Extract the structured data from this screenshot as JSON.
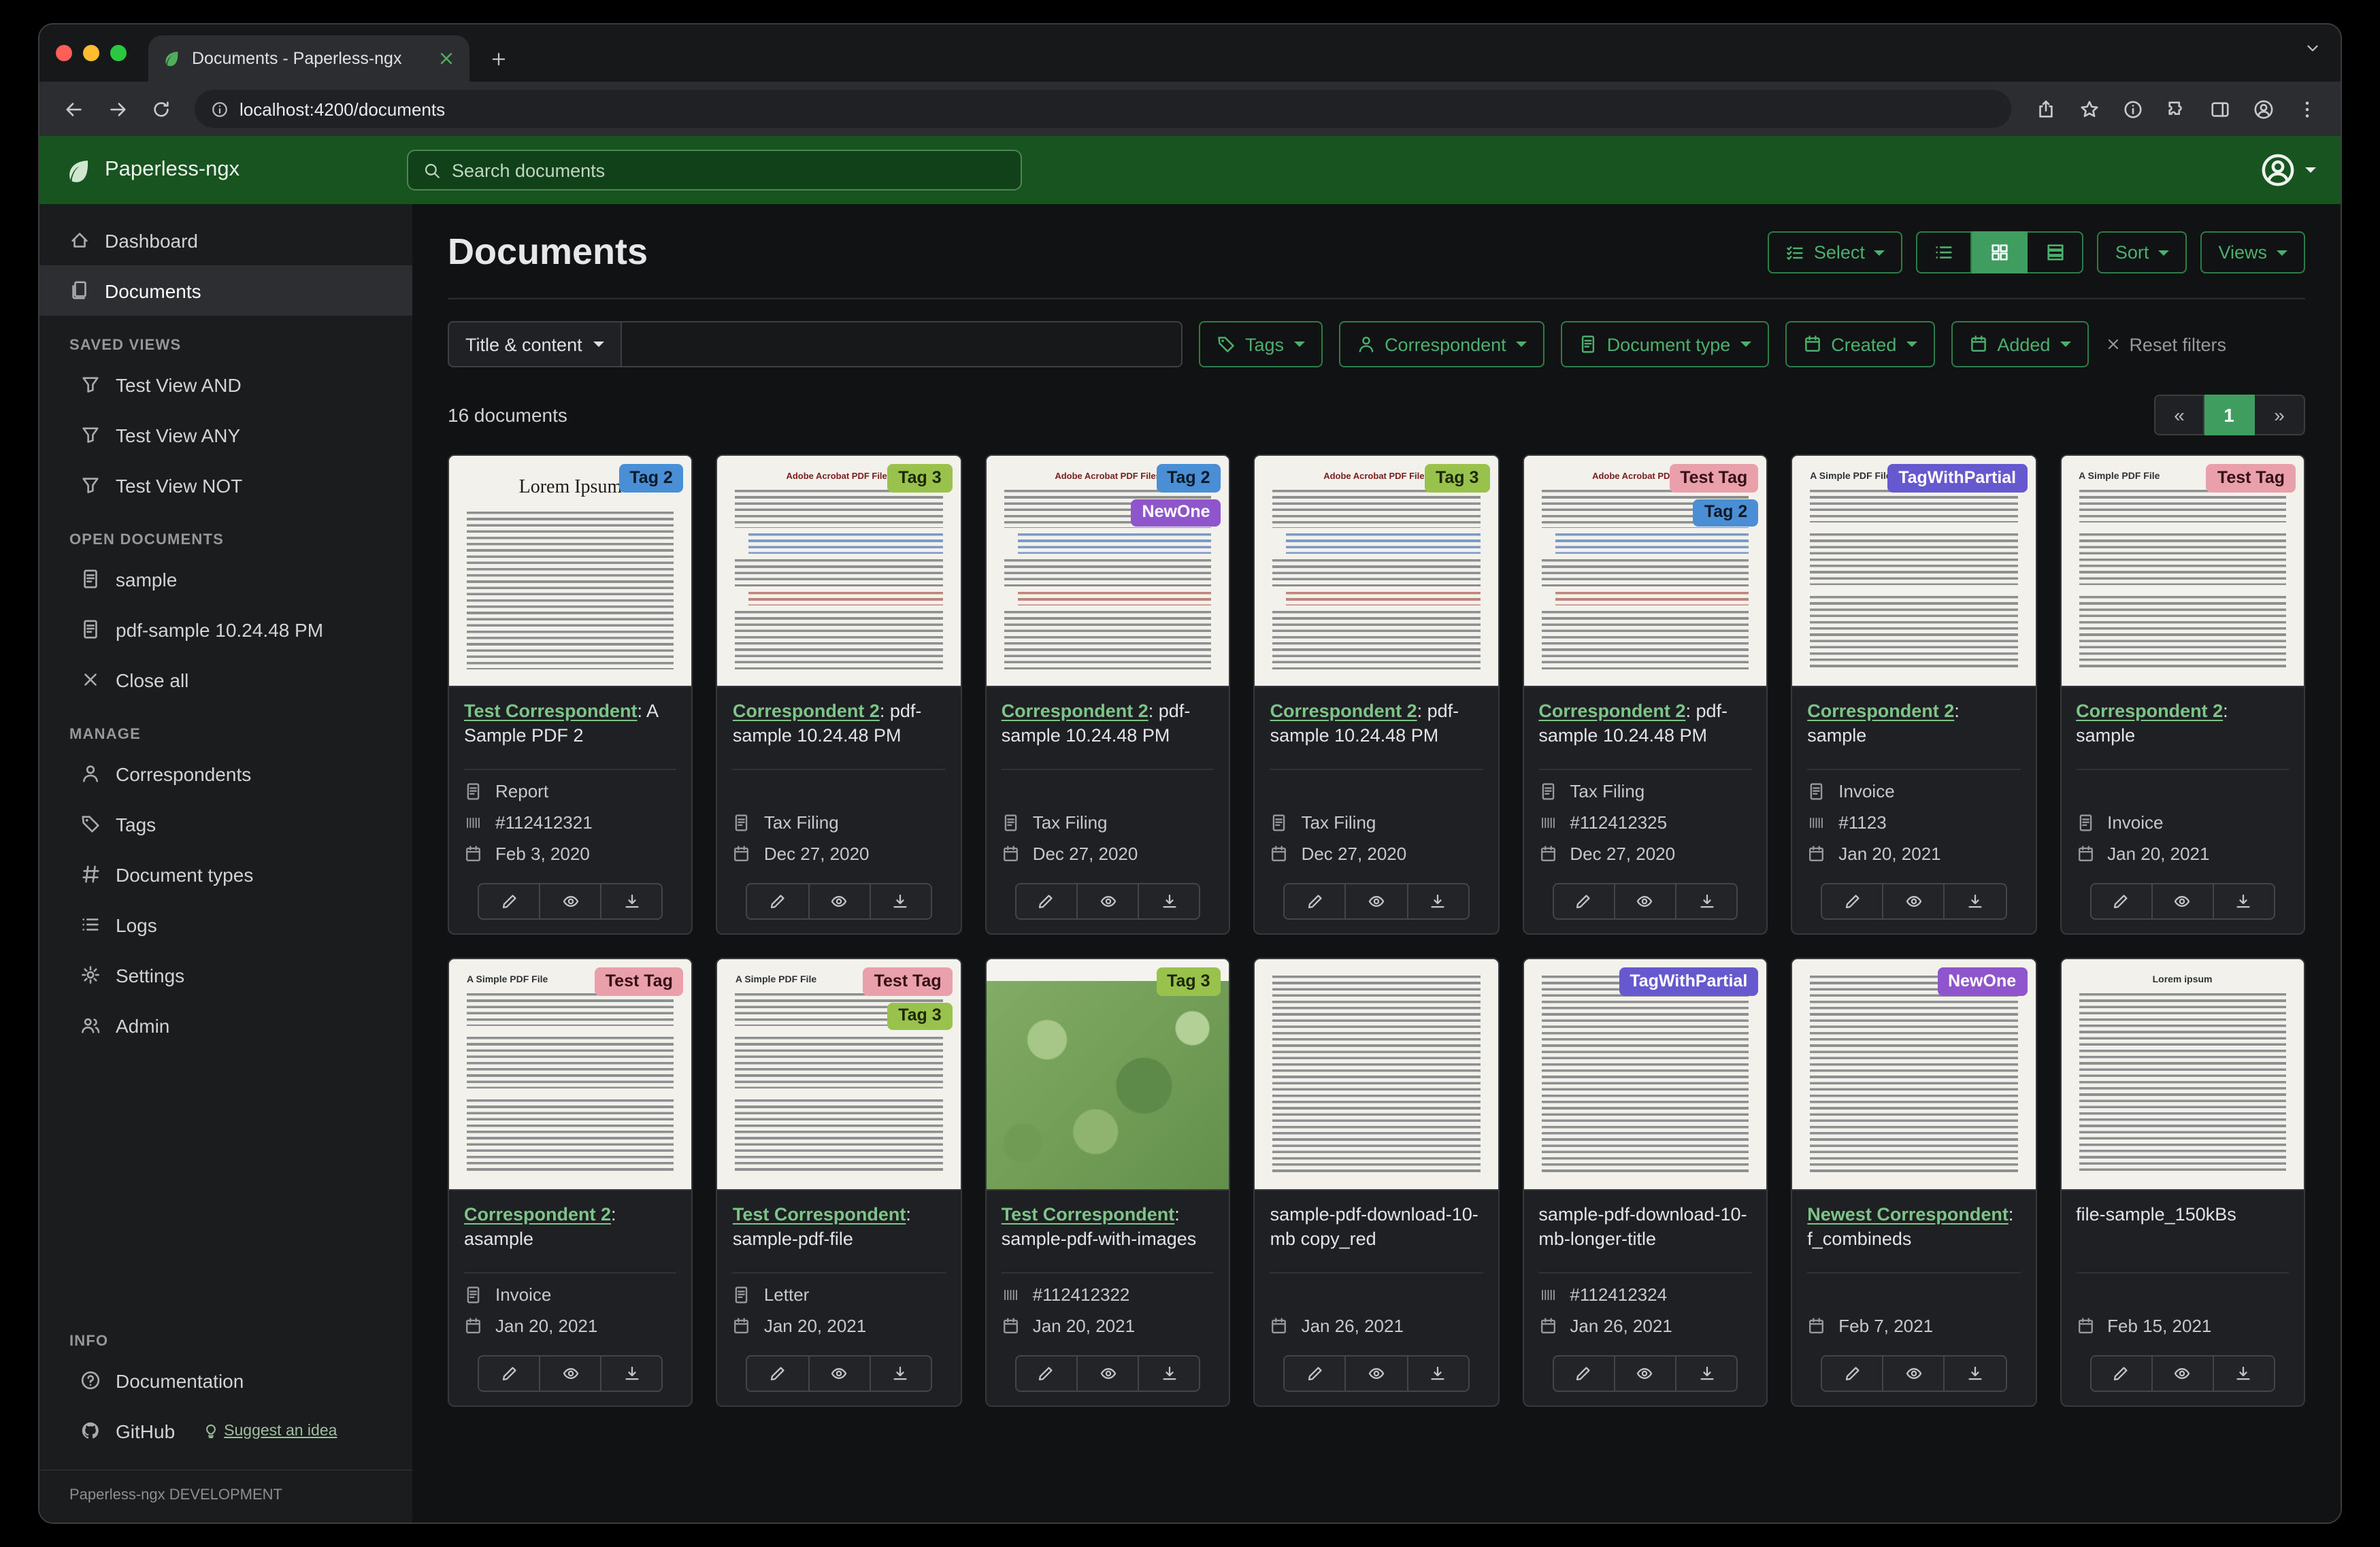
{
  "colors": {
    "brand_green": "#17541f",
    "accent": "#4caf6e",
    "accent_border": "#2e7d49",
    "accent_active": "#3f9e5f",
    "link": "#7ec488"
  },
  "browser": {
    "tab_title": "Documents - Paperless-ngx",
    "url": "localhost:4200/documents"
  },
  "navbar": {
    "brand": "Paperless-ngx",
    "search_placeholder": "Search documents"
  },
  "sidebar": {
    "top_items": [
      {
        "label": "Dashboard",
        "icon": "house"
      },
      {
        "label": "Documents",
        "icon": "files",
        "active": true
      }
    ],
    "sections": [
      {
        "title": "SAVED VIEWS",
        "items": [
          {
            "label": "Test View AND",
            "icon": "funnel"
          },
          {
            "label": "Test View ANY",
            "icon": "funnel"
          },
          {
            "label": "Test View NOT",
            "icon": "funnel"
          }
        ]
      },
      {
        "title": "OPEN DOCUMENTS",
        "items": [
          {
            "label": "sample",
            "icon": "file-text"
          },
          {
            "label": "pdf-sample 10.24.48 PM",
            "icon": "file-text"
          },
          {
            "label": "Close all",
            "icon": "x"
          }
        ]
      },
      {
        "title": "MANAGE",
        "items": [
          {
            "label": "Correspondents",
            "icon": "person"
          },
          {
            "label": "Tags",
            "icon": "tag"
          },
          {
            "label": "Document types",
            "icon": "hash"
          },
          {
            "label": "Logs",
            "icon": "list"
          },
          {
            "label": "Settings",
            "icon": "gear"
          },
          {
            "label": "Admin",
            "icon": "people"
          }
        ]
      },
      {
        "title": "INFO",
        "pin": true,
        "items": [
          {
            "label": "Documentation",
            "icon": "question"
          },
          {
            "label": "GitHub",
            "icon": "github",
            "extra_label": "Suggest an idea",
            "extra_icon": "bulb"
          }
        ]
      }
    ],
    "footer": "Paperless-ngx DEVELOPMENT"
  },
  "main": {
    "title": "Documents",
    "select_label": "Select",
    "sort_label": "Sort",
    "views_label": "Views",
    "count_text": "16 documents",
    "pagination": {
      "prev": "«",
      "page": "1",
      "next": "»"
    }
  },
  "filters": {
    "title_content_label": "Title & content",
    "query_value": "",
    "buttons": [
      {
        "label": "Tags",
        "icon": "tag"
      },
      {
        "label": "Correspondent",
        "icon": "person"
      },
      {
        "label": "Document type",
        "icon": "file-text"
      },
      {
        "label": "Created",
        "icon": "calendar"
      },
      {
        "label": "Added",
        "icon": "calendar"
      }
    ],
    "reset_label": "Reset filters"
  },
  "tag_colors": {
    "Tag 2": {
      "bg": "#4a8ed5",
      "fg": "#0c1a28"
    },
    "Tag 3": {
      "bg": "#98c24b",
      "fg": "#1c2608"
    },
    "NewOne": {
      "bg": "#8e55cc",
      "fg": "#ffffff"
    },
    "Test Tag": {
      "bg": "#e9a0ab",
      "fg": "#351016"
    },
    "TagWithPartial": {
      "bg": "#6658cf",
      "fg": "#ffffff"
    }
  },
  "cards": [
    {
      "tags": [
        "Tag 2"
      ],
      "thumb": {
        "kind": "lorem",
        "heading": "Lorem Ipsum"
      },
      "title_link": "Test Correspondent",
      "title_rest": ": A Sample PDF 2",
      "type": "Report",
      "asn": "#112412321",
      "date": "Feb 3, 2020"
    },
    {
      "tags": [
        "Tag 3"
      ],
      "thumb": {
        "kind": "acrobat",
        "heading": "Adobe Acrobat PDF Files"
      },
      "title_link": "Correspondent 2",
      "title_rest": ": pdf-sample 10.24.48 PM",
      "type": "Tax Filing",
      "date": "Dec 27, 2020"
    },
    {
      "tags": [
        "Tag 2",
        "NewOne"
      ],
      "thumb": {
        "kind": "acrobat",
        "heading": "Adobe Acrobat PDF Files"
      },
      "title_link": "Correspondent 2",
      "title_rest": ": pdf-sample 10.24.48 PM",
      "type": "Tax Filing",
      "date": "Dec 27, 2020"
    },
    {
      "tags": [
        "Tag 3"
      ],
      "thumb": {
        "kind": "acrobat",
        "heading": "Adobe Acrobat PDF Files"
      },
      "title_link": "Correspondent 2",
      "title_rest": ": pdf-sample 10.24.48 PM",
      "type": "Tax Filing",
      "date": "Dec 27, 2020"
    },
    {
      "tags": [
        "Test Tag",
        "Tag 2"
      ],
      "thumb": {
        "kind": "acrobat",
        "heading": "Adobe Acrobat PDF Files"
      },
      "title_link": "Correspondent 2",
      "title_rest": ": pdf-sample 10.24.48 PM",
      "type": "Tax Filing",
      "asn": "#112412325",
      "date": "Dec 27, 2020"
    },
    {
      "tags": [
        "TagWithPartial"
      ],
      "thumb": {
        "kind": "simple",
        "heading": "A Simple PDF File"
      },
      "title_link": "Correspondent 2",
      "title_rest": ": sample",
      "type": "Invoice",
      "asn": "#1123",
      "date": "Jan 20, 2021"
    },
    {
      "tags": [
        "Test Tag"
      ],
      "thumb": {
        "kind": "simple",
        "heading": "A Simple PDF File"
      },
      "title_link": "Correspondent 2",
      "title_rest": ": sample",
      "type": "Invoice",
      "date": "Jan 20, 2021"
    },
    {
      "tags": [
        "Test Tag"
      ],
      "thumb": {
        "kind": "simple",
        "heading": "A Simple PDF File"
      },
      "title_link": "Correspondent 2",
      "title_rest": ": asample",
      "type": "Invoice",
      "date": "Jan 20, 2021"
    },
    {
      "tags": [
        "Test Tag",
        "Tag 3"
      ],
      "thumb": {
        "kind": "simple",
        "heading": "A Simple PDF File"
      },
      "title_link": "Test Correspondent",
      "title_rest": ": sample-pdf-file",
      "type": "Letter",
      "date": "Jan 20, 2021"
    },
    {
      "tags": [
        "Tag 3"
      ],
      "thumb": {
        "kind": "map"
      },
      "title_link": "Test Correspondent",
      "title_rest": ": sample-pdf-with-images",
      "asn": "#112412322",
      "date": "Jan 20, 2021"
    },
    {
      "tags": [],
      "thumb": {
        "kind": "text"
      },
      "title_rest": "sample-pdf-download-10-mb copy_red",
      "date": "Jan 26, 2021"
    },
    {
      "tags": [
        "TagWithPartial"
      ],
      "thumb": {
        "kind": "text"
      },
      "title_rest": "sample-pdf-download-10-mb-longer-title",
      "asn": "#112412324",
      "date": "Jan 26, 2021"
    },
    {
      "tags": [
        "NewOne"
      ],
      "thumb": {
        "kind": "text"
      },
      "title_link": "Newest Correspondent",
      "title_rest": ": f_combineds",
      "date": "Feb 7, 2021"
    },
    {
      "tags": [],
      "thumb": {
        "kind": "lorem-center",
        "heading": "Lorem ipsum"
      },
      "title_rest": "file-sample_150kBs",
      "date": "Feb 15, 2021"
    }
  ]
}
